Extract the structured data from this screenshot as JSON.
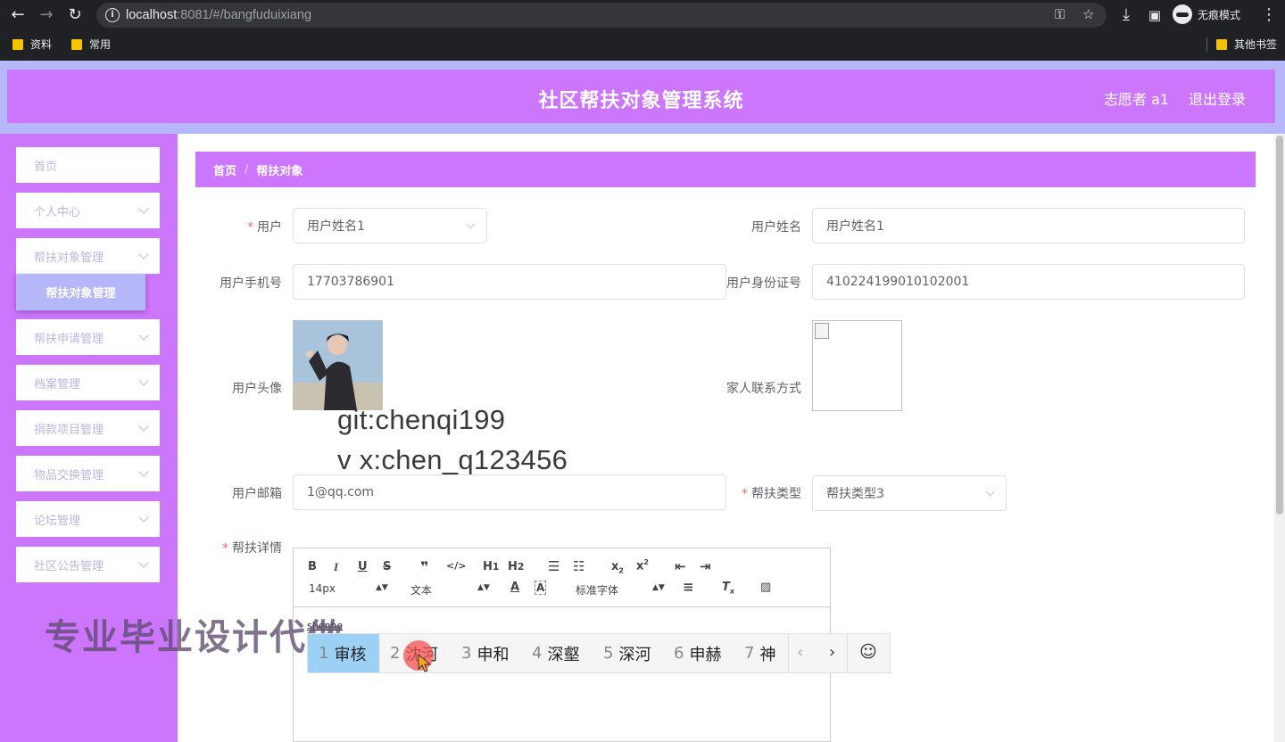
{
  "browser": {
    "url_host": "localhost",
    "url_rest": ":8081/#/bangfuduixiang",
    "incognito_label": "无痕模式",
    "bookmarks": [
      "资料",
      "常用"
    ],
    "other_bookmarks": "其他书签"
  },
  "header": {
    "title": "社区帮扶对象管理系统",
    "user": "志愿者 a1",
    "logout": "退出登录"
  },
  "sidebar": {
    "items": [
      {
        "label": "首页"
      },
      {
        "label": "个人中心"
      },
      {
        "label": "帮扶对象管理"
      },
      {
        "label": "帮扶申请管理"
      },
      {
        "label": "档案管理"
      },
      {
        "label": "捐款项目管理"
      },
      {
        "label": "物品交换管理"
      },
      {
        "label": "论坛管理"
      },
      {
        "label": "社区公告管理"
      }
    ],
    "active_sub": "帮扶对象管理"
  },
  "breadcrumb": {
    "home": "首页",
    "sep": "/",
    "current": "帮扶对象"
  },
  "form": {
    "user_label": "用户",
    "user_value": "用户姓名1",
    "name_label": "用户姓名",
    "name_value": "用户姓名1",
    "phone_label": "用户手机号",
    "phone_value": "17703786901",
    "idcard_label": "用户身份证号",
    "idcard_value": "410224199010102001",
    "avatar_label": "用户头像",
    "family_label": "家人联系方式",
    "email_label": "用户邮箱",
    "email_value": "1@qq.com",
    "type_label": "帮扶类型",
    "type_value": "帮扶类型3",
    "detail_label": "帮扶详情"
  },
  "watermarks": {
    "git": "git:chenqi199",
    "vx": "v x:chen_q123456",
    "promo": "专业毕业设计代做"
  },
  "editor": {
    "font_size": "14px",
    "block_type": "文本",
    "font_family": "标准字体",
    "pinyin": "shenhe"
  },
  "ime": {
    "candidates": [
      {
        "n": "1",
        "w": "审核"
      },
      {
        "n": "2",
        "w": "沈河"
      },
      {
        "n": "3",
        "w": "申和"
      },
      {
        "n": "4",
        "w": "深壑"
      },
      {
        "n": "5",
        "w": "深河"
      },
      {
        "n": "6",
        "w": "申赫"
      },
      {
        "n": "7",
        "w": "神"
      }
    ]
  },
  "colors": {
    "accent": "#cc75fd",
    "accent_light": "#b5b7f8",
    "required": "#f56c6c"
  }
}
